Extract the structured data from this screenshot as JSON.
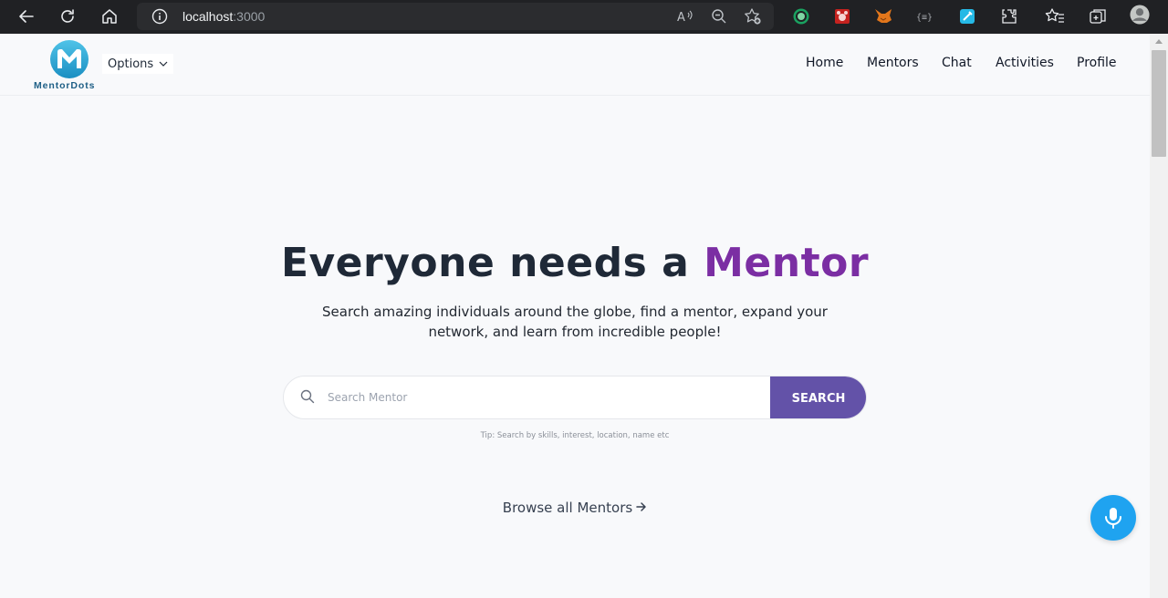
{
  "browser": {
    "url_host": "localhost",
    "url_port": ":3000",
    "icons": [
      "back-icon",
      "reload-icon",
      "home-icon",
      "info-icon",
      "read-aloud-icon",
      "zoom-icon",
      "favorite-add-icon",
      "extension-1-icon",
      "extension-2-icon",
      "metamask-icon",
      "extension-4-icon",
      "extension-5-icon",
      "extensions-icon",
      "favorites-icon",
      "collections-icon",
      "profile-avatar-icon"
    ]
  },
  "header": {
    "logo_text": "MentorDots",
    "options_label": "Options",
    "nav": [
      "Home",
      "Mentors",
      "Chat",
      "Activities",
      "Profile"
    ]
  },
  "hero": {
    "title_main": "Everyone needs a ",
    "title_accent": "Mentor",
    "subtitle": "Search amazing individuals around the globe, find a mentor, expand your network, and learn from incredible people!"
  },
  "search": {
    "placeholder": "Search Mentor",
    "button_label": "SEARCH",
    "tip": "Tip: Search by skills, interest, location, name etc"
  },
  "browse_link": "Browse all Mentors",
  "colors": {
    "accent_purple": "#7b2ea3",
    "search_button": "#6352a8",
    "mic_button": "#1fa3f0",
    "logo_teal": "#1e5f86"
  }
}
